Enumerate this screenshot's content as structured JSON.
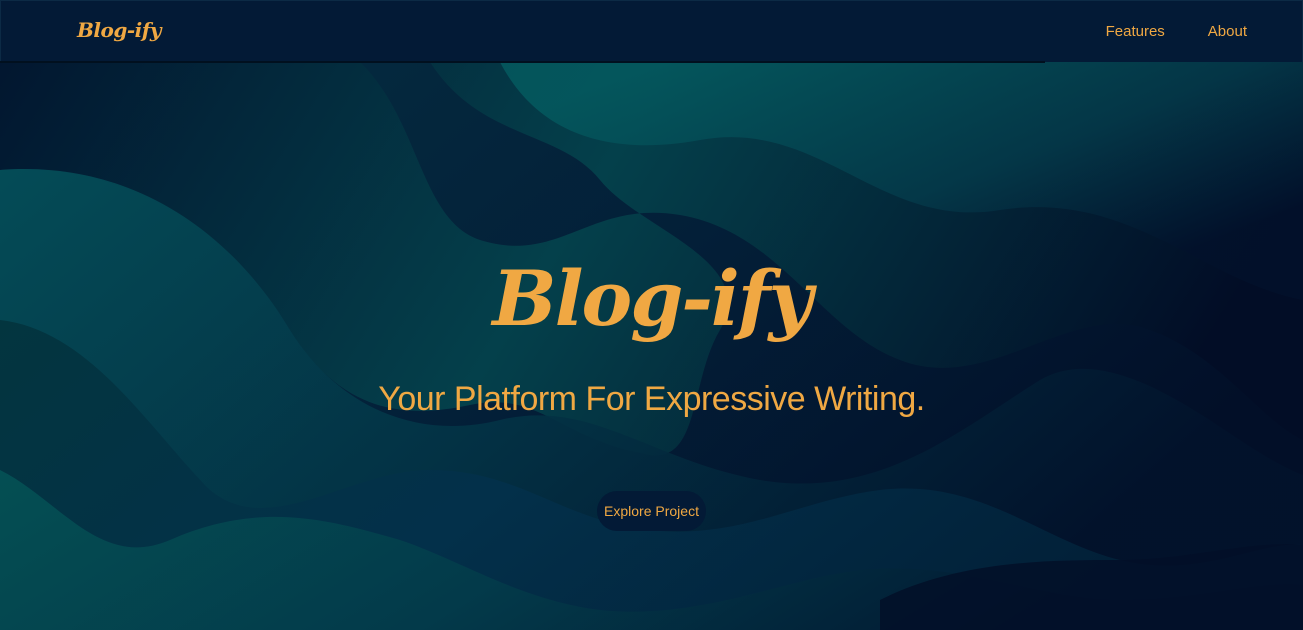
{
  "navbar": {
    "brand": "Blog-ify",
    "links": [
      {
        "label": "Features"
      },
      {
        "label": "About"
      }
    ]
  },
  "hero": {
    "title": "Blog-ify",
    "tagline": "Your Platform For Expressive Writing.",
    "cta_label": "Explore Project"
  },
  "colors": {
    "accent": "#f0a843",
    "navbar_bg": "#031a36",
    "wave_teal": "#03575c",
    "wave_navy": "#02132c"
  }
}
